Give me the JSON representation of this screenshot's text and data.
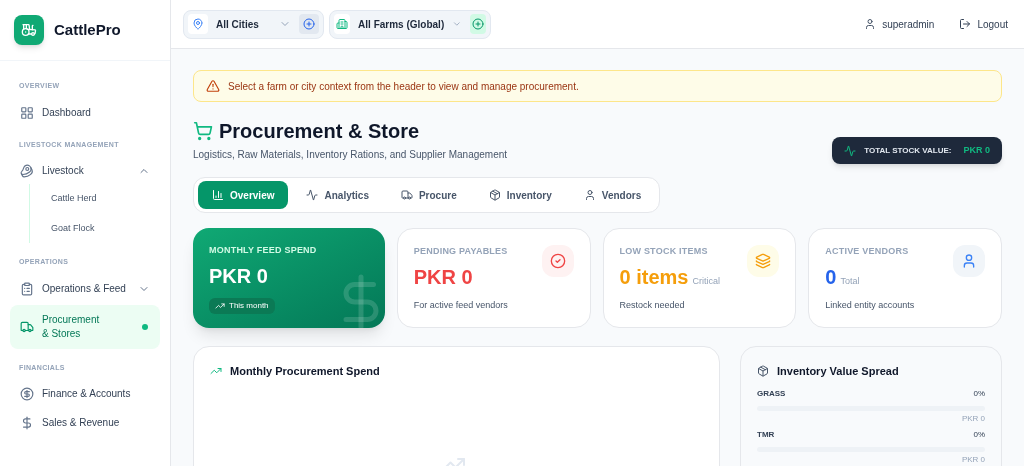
{
  "brand": {
    "name": "CattlePro"
  },
  "sidebar": {
    "sections": [
      {
        "title": "OVERVIEW",
        "items": [
          {
            "label": "Dashboard",
            "selected": false
          }
        ]
      },
      {
        "title": "LIVESTOCK MANAGEMENT",
        "items": [
          {
            "label": "Livestock",
            "selected": false,
            "expanded": true,
            "children": [
              {
                "label": "Cattle Herd",
                "selected": false
              },
              {
                "label": "Goat Flock",
                "selected": false
              }
            ]
          }
        ]
      },
      {
        "title": "OPERATIONS",
        "items": [
          {
            "label": "Operations & Feed",
            "selected": false,
            "expanded": false
          },
          {
            "label": "Procurement & Stores",
            "selected": true
          }
        ]
      },
      {
        "title": "FINANCIALS",
        "items": [
          {
            "label": "Finance & Accounts",
            "selected": false
          },
          {
            "label": "Sales & Revenue",
            "selected": false
          }
        ]
      }
    ]
  },
  "header": {
    "city_select": {
      "value": "All Cities"
    },
    "farm_select": {
      "value": "All Farms (Global)"
    },
    "user": "superadmin",
    "logout": "Logout"
  },
  "alert": {
    "text": "Select a farm or city context from the header to view and manage procurement."
  },
  "page": {
    "title": "Procurement & Store",
    "subtitle": "Logistics, Raw Materials, Inventory Rations, and Supplier Management",
    "total_stock": {
      "label": "TOTAL STOCK VALUE:",
      "value": "PKR 0"
    }
  },
  "tabs": [
    {
      "label": "Overview",
      "selected": true
    },
    {
      "label": "Analytics",
      "selected": false
    },
    {
      "label": "Procure",
      "selected": false
    },
    {
      "label": "Inventory",
      "selected": false
    },
    {
      "label": "Vendors",
      "selected": false
    }
  ],
  "stats": [
    {
      "kind": "highlight",
      "label": "MONTHLY FEED SPEND",
      "value": "PKR 0",
      "note": "This month"
    },
    {
      "kind": "danger",
      "label": "PENDING PAYABLES",
      "value": "PKR 0",
      "note": "For active feed vendors"
    },
    {
      "kind": "warning",
      "label": "LOW STOCK ITEMS",
      "value": "0 items",
      "suffix": "Critical",
      "note": "Restock needed"
    },
    {
      "kind": "info",
      "label": "ACTIVE VENDORS",
      "value": "0",
      "suffix": "Total",
      "note": "Linked entity accounts"
    }
  ],
  "spend_panel": {
    "title": "Monthly Procurement Spend"
  },
  "inventory_panel": {
    "title": "Inventory Value Spread",
    "items": [
      {
        "name": "GRASS",
        "percent": "0%",
        "level": 0,
        "value": "PKR 0"
      },
      {
        "name": "TMR",
        "percent": "0%",
        "level": 0,
        "value": "PKR 0"
      }
    ]
  }
}
